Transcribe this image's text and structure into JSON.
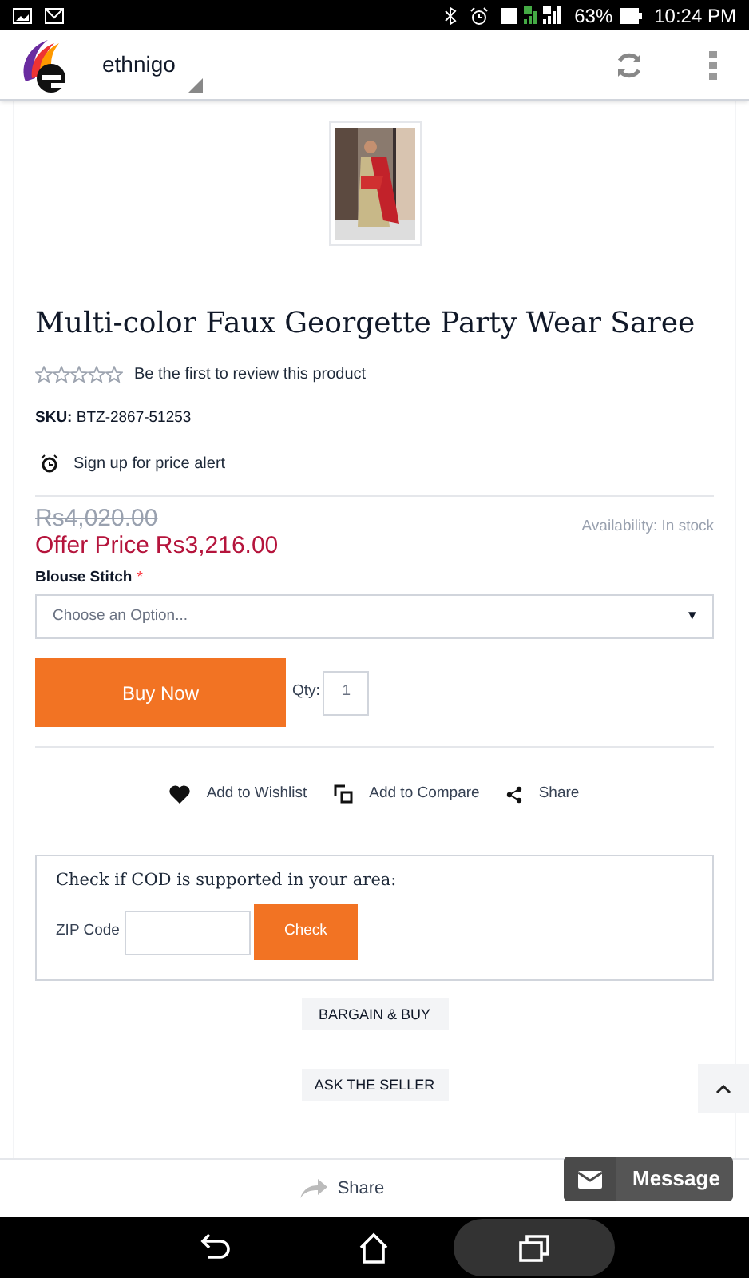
{
  "status_bar": {
    "battery": "63%",
    "time": "10:24 PM"
  },
  "app_bar": {
    "title": "ethnigo"
  },
  "product": {
    "title": "Multi-color Faux Georgette Party Wear Saree",
    "image": {
      "kind": "picture"
    },
    "rating": {
      "stars": 0,
      "text": "Be the first to review this product"
    },
    "sku_label": "SKU:",
    "sku": "BTZ-2867-51253",
    "price_alert": "Sign up for price alert",
    "old_price": "Rs4,020.00",
    "offer_label": "Offer Price",
    "offer_price": "Rs3,216.00",
    "availability": "Availability: In stock",
    "option_label": "Blouse Stitch",
    "required_mark": "*",
    "option_placeholder": "Choose an Option...",
    "option_caret": "▾",
    "buy_button": "Buy Now",
    "qty_label": "Qty:",
    "qty": "1",
    "actions": [
      {
        "kind": "wishlist",
        "label": "Add to Wishlist"
      },
      {
        "kind": "compare",
        "label": "Add to Compare"
      },
      {
        "kind": "share",
        "label": "Share"
      }
    ],
    "cod": {
      "title": "Check if COD is supported in your area:",
      "zip_label": "ZIP Code",
      "button": "Check"
    },
    "buttons": [
      "BARGAIN & BUY",
      "ASK THE SELLER"
    ]
  },
  "bottom_bar": {
    "share": "Share",
    "message": "Message"
  }
}
